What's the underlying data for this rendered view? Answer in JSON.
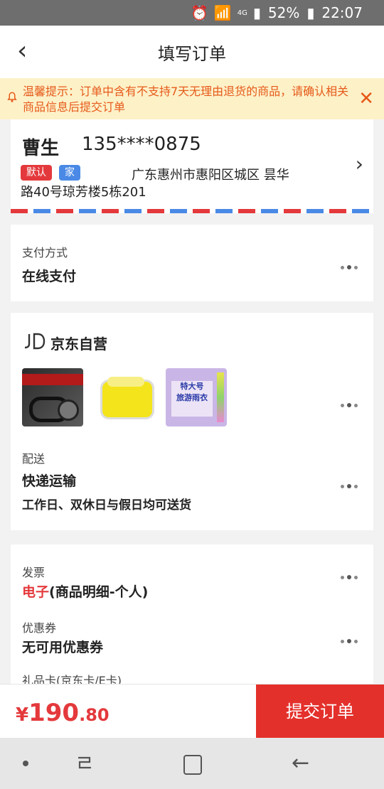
{
  "status": {
    "battery": "52%",
    "time": "22:07",
    "network": "4G"
  },
  "header": {
    "title": "填写订单"
  },
  "notice": {
    "text": "温馨提示：订单中含有不支持7天无理由退货的商品，请确认相关商品信息后提交订单"
  },
  "address": {
    "name": "曹生",
    "phone": "135****0875",
    "tag_default": "默认",
    "tag_home": "家",
    "line1": "广东惠州市惠阳区城区 昙华",
    "line2": "路40号琼芳楼5栋201"
  },
  "payment": {
    "label": "支付方式",
    "value": "在线支付"
  },
  "shop": {
    "name": "京东自营",
    "items": [
      {
        "icon": "auto-part-belt-kit"
      },
      {
        "icon": "air-freshener-can"
      },
      {
        "icon": "raincoat-pack",
        "text": "特大号\n旅游雨衣"
      }
    ],
    "delivery_label": "配送",
    "delivery_value": "快递运输",
    "delivery_note": "工作日、双休日与假日均可送货"
  },
  "invoice": {
    "label": "发票",
    "value_red": "电子",
    "value_rest": "(商品明细-个人)",
    "coupon_label": "优惠券",
    "coupon_value": "无可用优惠券",
    "giftcard_label": "礼品卡(京东卡/E卡)"
  },
  "checkout": {
    "currency": "¥",
    "price_int": "190",
    "price_dec": ".80",
    "submit_label": "提交订单"
  },
  "colors": {
    "accent": "#e4393c",
    "notice_bg": "#fdf1c8",
    "notice_text": "#e65a1a"
  }
}
